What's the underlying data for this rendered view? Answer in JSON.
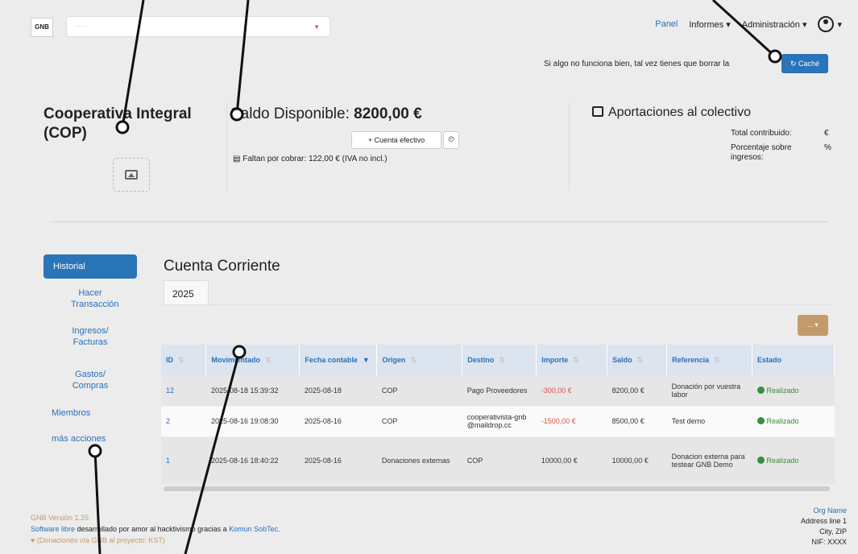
{
  "header": {
    "logo_text": "GNB",
    "org_select_placeholder": "········",
    "nav": {
      "panel": "Panel",
      "informes": "Informes ▾",
      "administracion": "Administración ▾",
      "user_caret": "▾"
    }
  },
  "notice": {
    "text": "Si algo no funciona bien, tal vez tienes que borrar la",
    "cache_button": "↻ Caché"
  },
  "org": {
    "name": "Cooperativa Integral (COP)"
  },
  "balance": {
    "label": "Saldo Disponible:",
    "value": "8200,00 €",
    "cash_button": "+ Cuenta efectivo",
    "history_icon": "⏲",
    "pending": "Faltan por cobrar: 122,00 € (IVA no incl.)"
  },
  "contributions": {
    "title": "Aportaciones al colectivo",
    "rows": [
      {
        "label": "Total contribuido:",
        "unit": "€"
      },
      {
        "label": "Porcentaje sobre ingresos:",
        "unit": "%"
      }
    ]
  },
  "sidebar": {
    "items": [
      {
        "label": "Historial"
      },
      {
        "label": "Hacer Transacción"
      },
      {
        "label": "Ingresos/ Facturas"
      },
      {
        "label": "Gastos/ Compras"
      },
      {
        "label": "Miembros"
      },
      {
        "label": "más acciones"
      }
    ]
  },
  "main": {
    "title": "Cuenta Corriente",
    "year_tab": "2025",
    "actions_button": "... ▾",
    "columns": [
      "ID",
      "Movimientado",
      "Fecha contable",
      "Origen",
      "Destino",
      "Importe",
      "Saldo",
      "Referencia",
      "Estado"
    ],
    "rows": [
      {
        "id": "12",
        "mov": "2025-08-18 15:39:32",
        "fecha": "2025-08-18",
        "origen": "COP",
        "destino": "Pago Proveedores",
        "importe": "-300,00 €",
        "saldo": "8200,00 €",
        "referencia": "Donación por vuestra labor",
        "estado": "Realizado"
      },
      {
        "id": "2",
        "mov": "2025-08-16 19:08:30",
        "fecha": "2025-08-16",
        "origen": "COP",
        "destino": "cooperativista-gnb@maildrop.cc",
        "importe": "-1500,00 €",
        "saldo": "8500,00 €",
        "referencia": "Test demo",
        "estado": "Realizado"
      },
      {
        "id": "1",
        "mov": "2025-08-16 18:40:22",
        "fecha": "2025-08-16",
        "origen": "Donaciones externas",
        "destino": "COP",
        "importe": "10000,00 €",
        "saldo": "10000,00 €",
        "referencia": "Donacion externa para testear GNB Demo",
        "estado": "Realizado"
      }
    ]
  },
  "footer": {
    "version": "GNB Versión 1.25",
    "line2_a": "Software libre",
    "line2_b": " desarrollado por amor al hacktivismo gracias a ",
    "line2_c": "Komun SobTec.",
    "line3": "♥ (Donaciones vía GNB al proyecto: KST)",
    "org_name": "Org Name",
    "address": "Address line 1",
    "city": "City, ZIP",
    "nif": "NIF: XXXX"
  },
  "colors": {
    "primary": "#2a74b8",
    "accent": "#c49a6c",
    "negative": "#d9534f",
    "success": "#3c8c3c"
  }
}
